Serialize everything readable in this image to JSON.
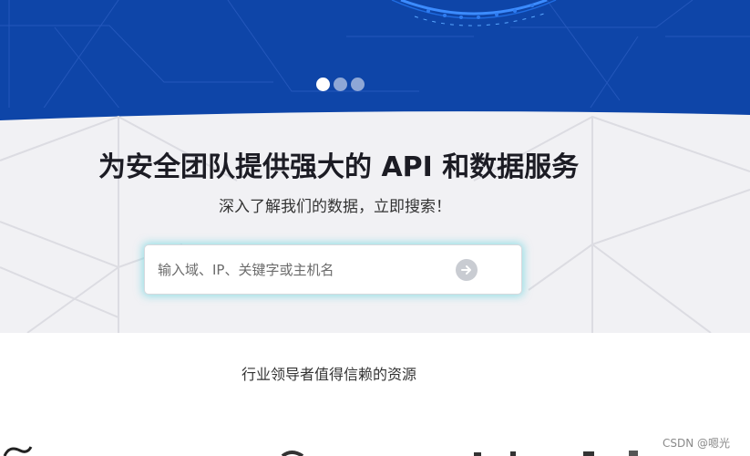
{
  "hero": {
    "carousel": {
      "slide_count": 3,
      "active_index": 0
    }
  },
  "search_section": {
    "headline": "为安全团队提供强大的 API 和数据服务",
    "subheadline": "深入了解我们的数据，立即搜索！",
    "search": {
      "placeholder": "输入域、IP、关键字或主机名",
      "value": "",
      "submit_icon": "arrow-right-circle-icon"
    }
  },
  "trust": {
    "heading": "行业领导者值得信赖的资源"
  },
  "watermark": "CSDN @嗯光",
  "colors": {
    "banner": "#0e45a8",
    "section_bg": "#f1f1f4",
    "glow": "#50d2dc",
    "headline": "#1c1c24"
  }
}
